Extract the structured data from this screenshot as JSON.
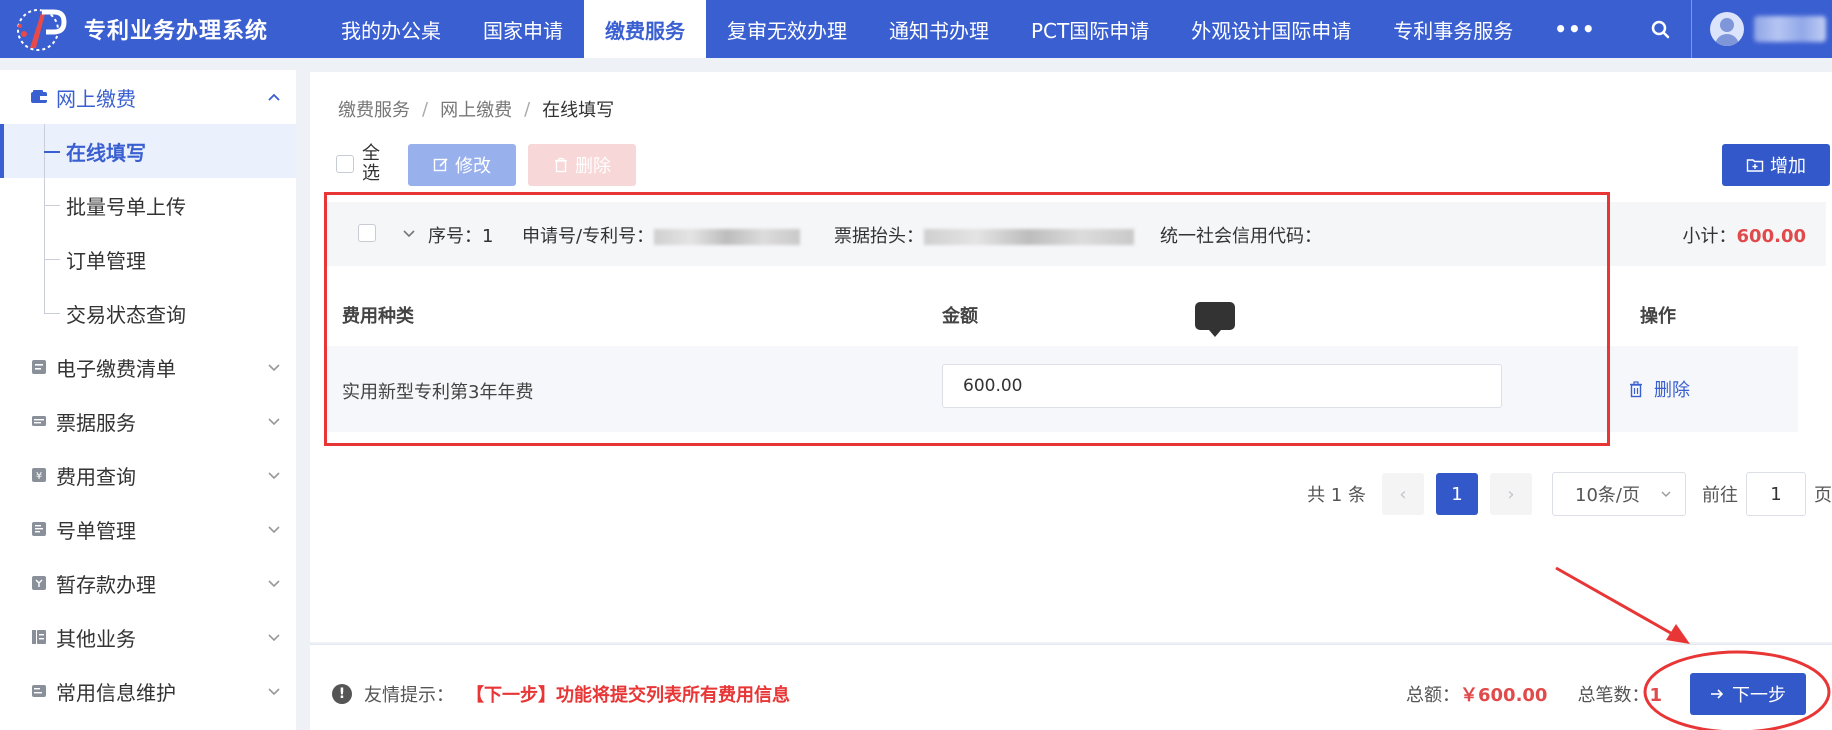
{
  "app": {
    "title": "专利业务办理系统"
  },
  "nav": {
    "items": [
      {
        "label": "我的办公桌",
        "active": false
      },
      {
        "label": "国家申请",
        "active": false
      },
      {
        "label": "缴费服务",
        "active": true
      },
      {
        "label": "复审无效办理",
        "active": false
      },
      {
        "label": "通知书办理",
        "active": false
      },
      {
        "label": "PCT国际申请",
        "active": false
      },
      {
        "label": "外观设计国际申请",
        "active": false
      },
      {
        "label": "专利事务服务",
        "active": false
      }
    ],
    "more": "•••"
  },
  "sidebar": {
    "open_group": {
      "label": "网上缴费",
      "icon": "wallet-icon"
    },
    "sub_items": [
      {
        "label": "在线填写",
        "active": true
      },
      {
        "label": "批量号单上传",
        "active": false
      },
      {
        "label": "订单管理",
        "active": false
      },
      {
        "label": "交易状态查询",
        "active": false
      }
    ],
    "groups": [
      {
        "label": "电子缴费清单",
        "icon": "fee-list-icon"
      },
      {
        "label": "票据服务",
        "icon": "ticket-icon"
      },
      {
        "label": "费用查询",
        "icon": "yuan-icon"
      },
      {
        "label": "号单管理",
        "icon": "list-icon"
      },
      {
        "label": "暂存款办理",
        "icon": "deposit-icon"
      },
      {
        "label": "其他业务",
        "icon": "stack-icon"
      },
      {
        "label": "常用信息维护",
        "icon": "card-icon"
      }
    ]
  },
  "breadcrumb": [
    "缴费服务",
    "网上缴费",
    "在线填写"
  ],
  "toolbar": {
    "select_all": "全选",
    "edit": "修改",
    "delete": "删除",
    "add": "增加"
  },
  "record": {
    "seq_label": "序号：",
    "seq_value": "1",
    "app_no_label": "申请号/专利号：",
    "invoice_title_label": "票据抬头：",
    "credit_code_label": "统一社会信用代码：",
    "subtotal_label": "小计：",
    "subtotal_value": "600.00"
  },
  "table": {
    "headers": {
      "fee_type": "费用种类",
      "amount": "金额",
      "action": "操作"
    },
    "rows": [
      {
        "fee_type": "实用新型专利第3年年费",
        "amount": "600.00",
        "action": "删除"
      }
    ]
  },
  "pagination": {
    "total": "共 1 条",
    "prev": "‹",
    "current": "1",
    "next": "›",
    "page_size": "10条/页",
    "goto_label": "前往",
    "goto_value": "1",
    "page_unit": "页"
  },
  "footer": {
    "tip_label": "友情提示：",
    "tip_text": "【下一步】功能将提交列表所有费用信息",
    "total_label": "总额：",
    "total_value": "￥600.00",
    "count_label": "总笔数：",
    "count_value": "1",
    "next_button": "下一步"
  },
  "colors": {
    "primary": "#3a5fd1",
    "danger": "#e04a4a",
    "annotation": "#e83535"
  }
}
